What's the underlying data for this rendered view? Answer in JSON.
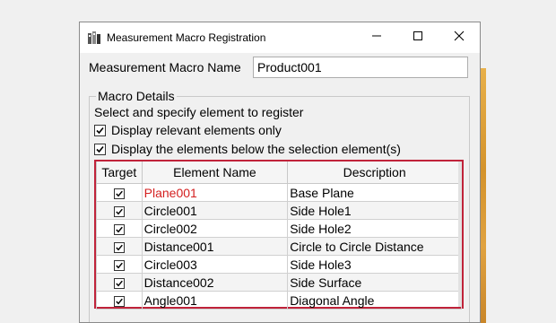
{
  "window": {
    "title": "Measurement Macro Registration",
    "icon": "app-icon",
    "controls": [
      "minimize-icon",
      "maximize-icon",
      "close-icon"
    ]
  },
  "form": {
    "macro_name_label": "Measurement Macro Name",
    "macro_name_value": "Product001"
  },
  "macro_details": {
    "legend": "Macro Details",
    "instruction": "Select and specify element to register",
    "options": [
      {
        "label": "Display relevant elements only",
        "checked": true
      },
      {
        "label": "Display the elements below the selection element(s)",
        "checked": true
      }
    ]
  },
  "table": {
    "columns": [
      "Target",
      "Element Name",
      "Description"
    ],
    "rows": [
      {
        "target": true,
        "name": "Plane001",
        "description": "Base Plane",
        "highlight_color": "#d42020"
      },
      {
        "target": true,
        "name": "Circle001",
        "description": "Side Hole1"
      },
      {
        "target": true,
        "name": "Circle002",
        "description": "Side Hole2"
      },
      {
        "target": true,
        "name": "Distance001",
        "description": "Circle to Circle Distance"
      },
      {
        "target": true,
        "name": "Circle003",
        "description": "Side Hole3"
      },
      {
        "target": true,
        "name": "Distance002",
        "description": "Side Surface"
      },
      {
        "target": true,
        "name": "Angle001",
        "description": "Diagonal Angle"
      }
    ],
    "frame_color": "#c0233a"
  }
}
